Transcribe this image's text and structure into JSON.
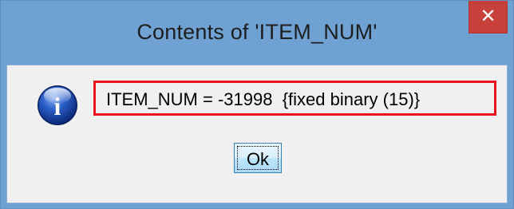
{
  "window": {
    "title": "Contents of 'ITEM_NUM'",
    "close_icon": "close-icon",
    "close_glyph": "✕"
  },
  "dialog": {
    "icon": "info-icon",
    "icon_letter": "i",
    "message": "ITEM_NUM = -31998  {fixed binary (15)}",
    "ok_label": "Ok"
  },
  "colors": {
    "title_bar": "#6fa2d3",
    "close_button": "#c7403a",
    "highlight_border": "#e8141f",
    "client_background": "#f0f0f0"
  }
}
